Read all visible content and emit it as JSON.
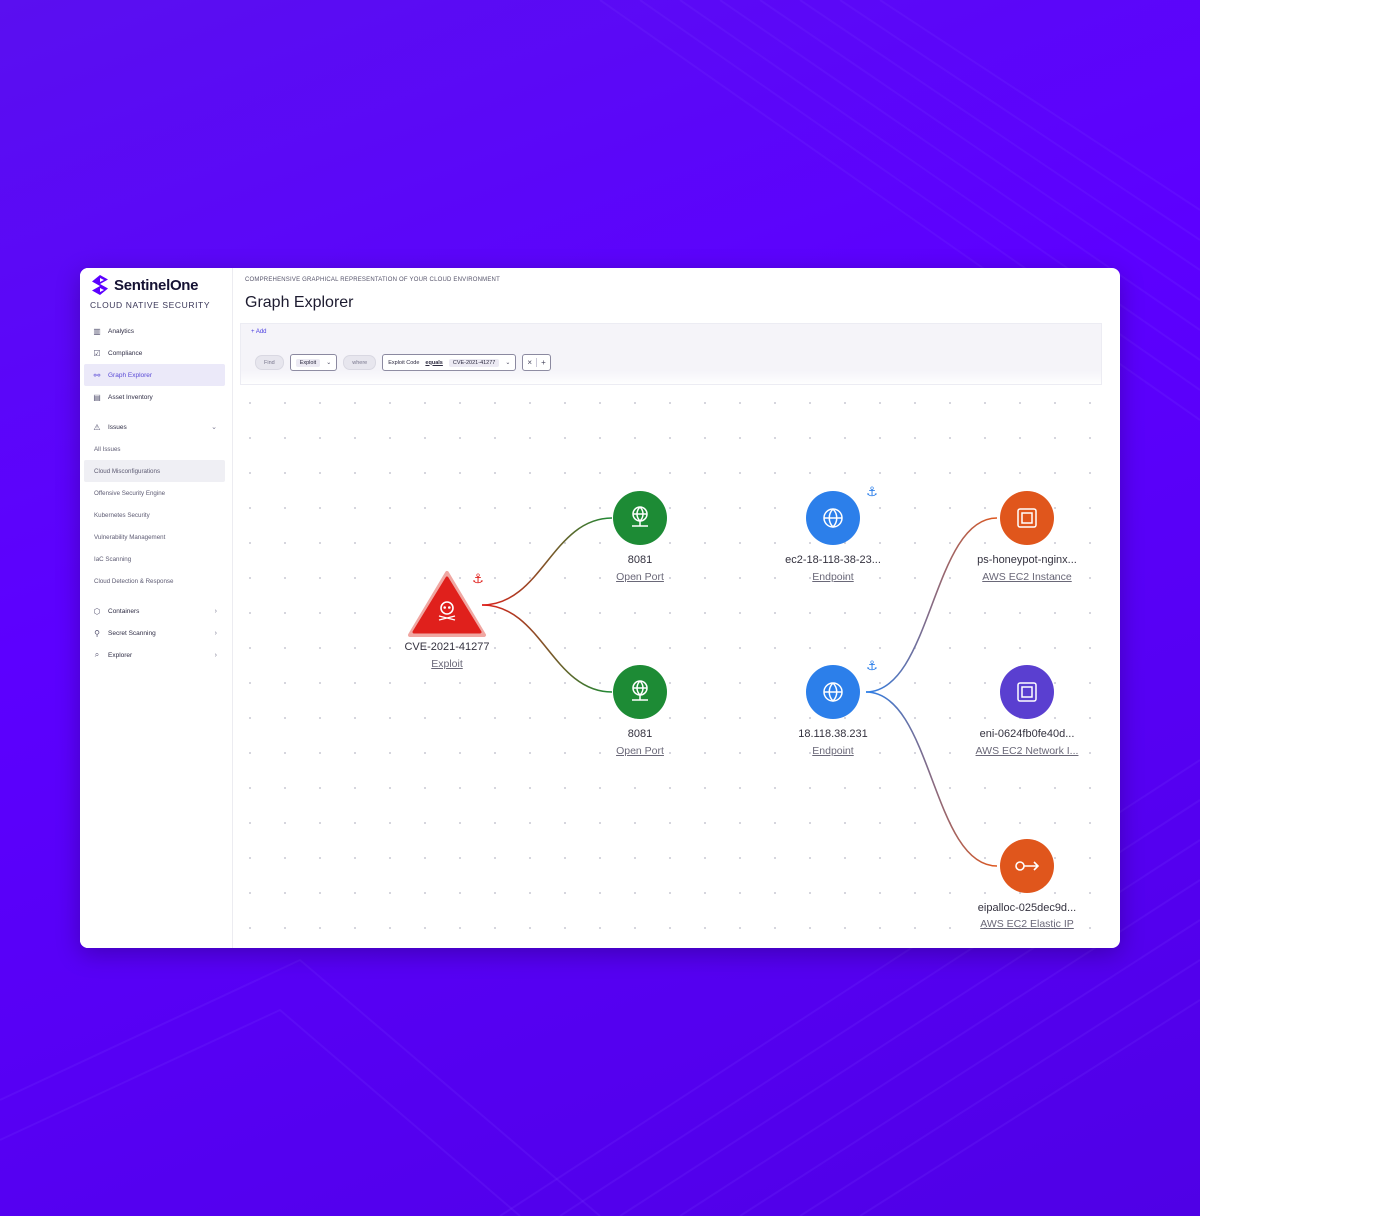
{
  "brand": {
    "name": "SentinelOne",
    "subtitle": "CLOUD NATIVE SECURITY",
    "accent": "#5c00ff"
  },
  "sidebar": {
    "items": [
      {
        "label": "Analytics",
        "icon": "bar-chart-icon"
      },
      {
        "label": "Compliance",
        "icon": "check-square-icon"
      },
      {
        "label": "Graph Explorer",
        "icon": "graph-icon",
        "active": true
      },
      {
        "label": "Asset Inventory",
        "icon": "inventory-icon"
      }
    ],
    "issues": {
      "label": "Issues",
      "icon": "warning-icon",
      "subitems": [
        "All Issues",
        "Cloud Misconfigurations",
        "Offensive Security Engine",
        "Kubernetes Security",
        "Vulnerability Management",
        "IaC Scanning",
        "Cloud Detection & Response"
      ]
    },
    "bottom_items": [
      {
        "label": "Containers",
        "icon": "container-icon"
      },
      {
        "label": "Secret Scanning",
        "icon": "key-icon"
      },
      {
        "label": "Explorer",
        "icon": "search-icon"
      }
    ]
  },
  "page": {
    "kicker": "COMPREHENSIVE GRAPHICAL REPRESENTATION OF YOUR CLOUD ENVIRONMENT",
    "title": "Graph Explorer"
  },
  "query": {
    "add_label": "+ Add",
    "find_label": "Find",
    "entity_value": "Exploit",
    "where_label": "where",
    "condition_field": "Exploit Code",
    "condition_operator": "equals",
    "condition_value": "CVE-2021-41277"
  },
  "graph": {
    "nodes": [
      {
        "id": "exploit",
        "label": "CVE-2021-41277",
        "type": "Exploit",
        "color": "#e0201c",
        "icon": "skull-icon"
      },
      {
        "id": "port1",
        "label": "8081",
        "type": "Open Port",
        "color": "#1d8b35",
        "icon": "network-globe-icon"
      },
      {
        "id": "port2",
        "label": "8081",
        "type": "Open Port",
        "color": "#1d8b35",
        "icon": "network-globe-icon"
      },
      {
        "id": "ep1",
        "label": "ec2-18-118-38-23...",
        "type": "Endpoint",
        "color": "#2c7fea",
        "icon": "globe-icon"
      },
      {
        "id": "ep2",
        "label": "18.118.38.231",
        "type": "Endpoint",
        "color": "#2c7fea",
        "icon": "globe-icon"
      },
      {
        "id": "inst",
        "label": "ps-honeypot-nginx...",
        "type": "AWS EC2 Instance",
        "color": "#e0561c",
        "icon": "chip-icon"
      },
      {
        "id": "eni",
        "label": "eni-0624fb0fe40d...",
        "type": "AWS EC2 Network I...",
        "color": "#5a3fd0",
        "icon": "chip-icon"
      },
      {
        "id": "eip",
        "label": "eipalloc-025dec9d...",
        "type": "AWS EC2 Elastic IP",
        "color": "#e0561c",
        "icon": "key-arrow-icon"
      }
    ]
  }
}
